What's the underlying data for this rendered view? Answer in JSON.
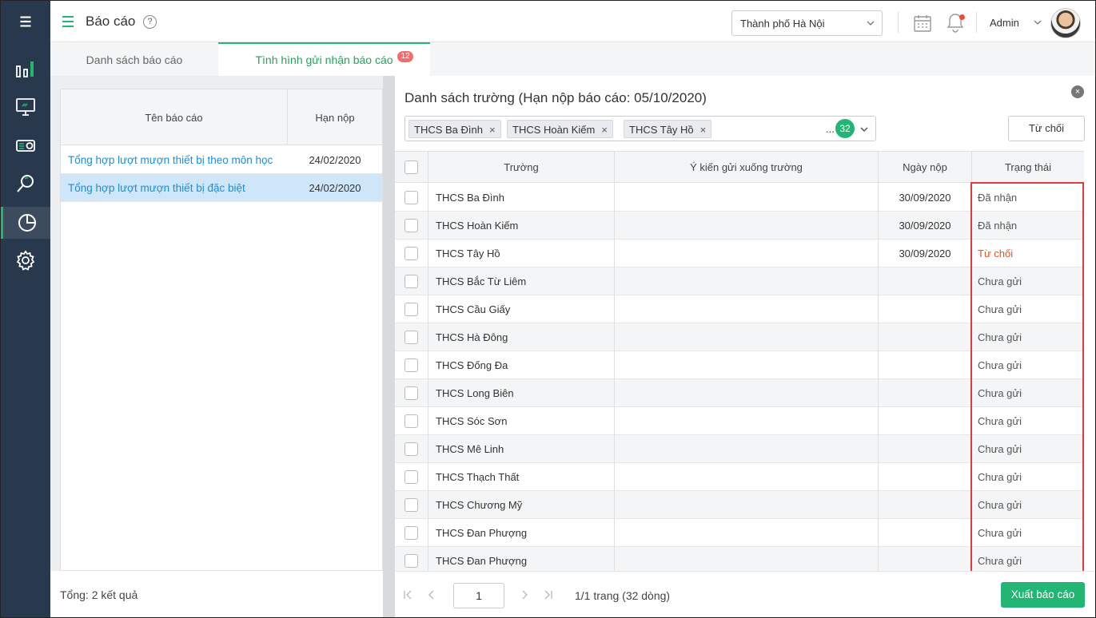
{
  "sidebar": {
    "items": [
      "menu",
      "dashboard",
      "monitor",
      "equipment",
      "search",
      "report",
      "settings"
    ],
    "active": "report"
  },
  "header": {
    "title": "Báo cáo",
    "help_icon": "?",
    "city": "Thành phố Hà Nội",
    "user": "Admin"
  },
  "tabs": [
    {
      "label": "Danh sách báo cáo",
      "active": false
    },
    {
      "label": "Tình hình gửi nhận báo cáo",
      "active": true,
      "badge": "12"
    }
  ],
  "reports": {
    "col_name": "Tên báo cáo",
    "col_deadline": "Hạn nộp",
    "rows": [
      {
        "name": "Tổng hợp lượt mượn thiết bị theo môn học",
        "deadline": "24/02/2020",
        "selected": false
      },
      {
        "name": "Tổng hợp lượt mượn thiết bị đặc biệt",
        "deadline": "24/02/2020",
        "selected": true
      }
    ],
    "total": "Tổng: 2 kết quả"
  },
  "schools": {
    "title": "Danh sách trường (Hạn nộp báo cáo: 05/10/2020)",
    "close": "×",
    "chips": [
      "THCS Ba Đình",
      "THCS  Hoàn Kiếm",
      "THCS  Tây Hồ"
    ],
    "chip_remove": "×",
    "more": "...",
    "chip_count": "32",
    "reject_button": "Từ chối",
    "columns": {
      "school": "Trường",
      "comment": "Ý kiến gửi xuống trường",
      "date": "Ngày nộp",
      "status": "Trạng thái"
    },
    "rows": [
      {
        "school": "THCS Ba Đình",
        "date": "30/09/2020",
        "status": "Đã nhận"
      },
      {
        "school": "THCS  Hoàn Kiếm",
        "date": "30/09/2020",
        "status": "Đã nhận"
      },
      {
        "school": "THCS  Tây Hồ",
        "date": "30/09/2020",
        "status": "Từ chối"
      },
      {
        "school": "THCS  Bắc Từ Liêm",
        "date": "",
        "status": "Chưa gửi"
      },
      {
        "school": "THCS  Cầu Giấy",
        "date": "",
        "status": "Chưa gửi"
      },
      {
        "school": "THCS  Hà Đông",
        "date": "",
        "status": "Chưa gửi"
      },
      {
        "school": "THCS  Đống Đa",
        "date": "",
        "status": "Chưa gửi"
      },
      {
        "school": "THCS  Long Biên",
        "date": "",
        "status": "Chưa gửi"
      },
      {
        "school": "THCS  Sóc Sơn",
        "date": "",
        "status": "Chưa gửi"
      },
      {
        "school": "THCS  Mê Linh",
        "date": "",
        "status": "Chưa gửi"
      },
      {
        "school": "THCS  Thạch Thất",
        "date": "",
        "status": "Chưa gửi"
      },
      {
        "school": "THCS  Chương Mỹ",
        "date": "",
        "status": "Chưa gửi"
      },
      {
        "school": "THCS  Đan Phượng",
        "date": "",
        "status": "Chưa gửi"
      },
      {
        "school": "THCS  Đan Phượng",
        "date": "",
        "status": "Chưa gửi"
      }
    ],
    "page": "1",
    "page_info": "1/1 trang (32 dòng)",
    "export_button": "Xuất báo cáo"
  },
  "colors": {
    "accent": "#22b573",
    "link": "#1a8ed6",
    "reject": "#e8541e",
    "highlight": "#e23b3b",
    "sidebar": "#29394d"
  }
}
